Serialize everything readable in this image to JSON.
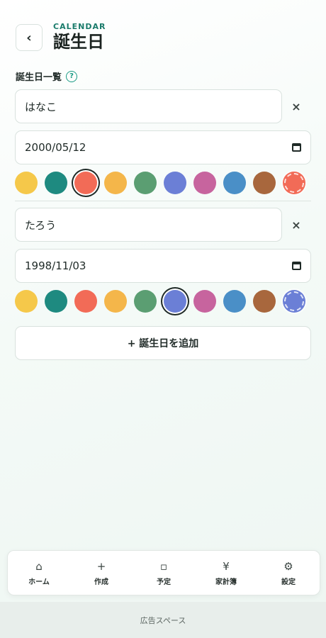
{
  "header": {
    "eyebrow": "CALENDAR",
    "title": "誕生日",
    "back_icon": "chevron-left-icon",
    "back_glyph": "‹"
  },
  "section": {
    "label": "誕生日一覧",
    "help_glyph": "?"
  },
  "colors": {
    "accent": "#1a9b84",
    "brand": "#1a7b6b"
  },
  "palette": [
    "#f5c84a",
    "#1e8a80",
    "#f26b57",
    "#f4b64a",
    "#5b9e72",
    "#6b7fd6",
    "#c7649e",
    "#4a8fc7",
    "#a8673d"
  ],
  "birthdays": [
    {
      "name": "はなこ",
      "date": "2000/05/12",
      "selected_index": 2,
      "current_color": "#f26b57"
    },
    {
      "name": "たろう",
      "date": "1998/11/03",
      "selected_index": 5,
      "current_color": "#6b7fd6"
    }
  ],
  "remove_glyph": "×",
  "add_button": {
    "label": "+ 誕生日を追加"
  },
  "nav": [
    {
      "label": "ホーム",
      "icon": "home-icon",
      "glyph": "⌂"
    },
    {
      "label": "作成",
      "icon": "plus-icon",
      "glyph": "+"
    },
    {
      "label": "予定",
      "icon": "square-icon",
      "glyph": "▫"
    },
    {
      "label": "家計簿",
      "icon": "yen-icon",
      "glyph": "¥"
    },
    {
      "label": "設定",
      "icon": "gear-icon",
      "glyph": "⚙"
    }
  ],
  "ad": {
    "label": "広告スペース"
  }
}
